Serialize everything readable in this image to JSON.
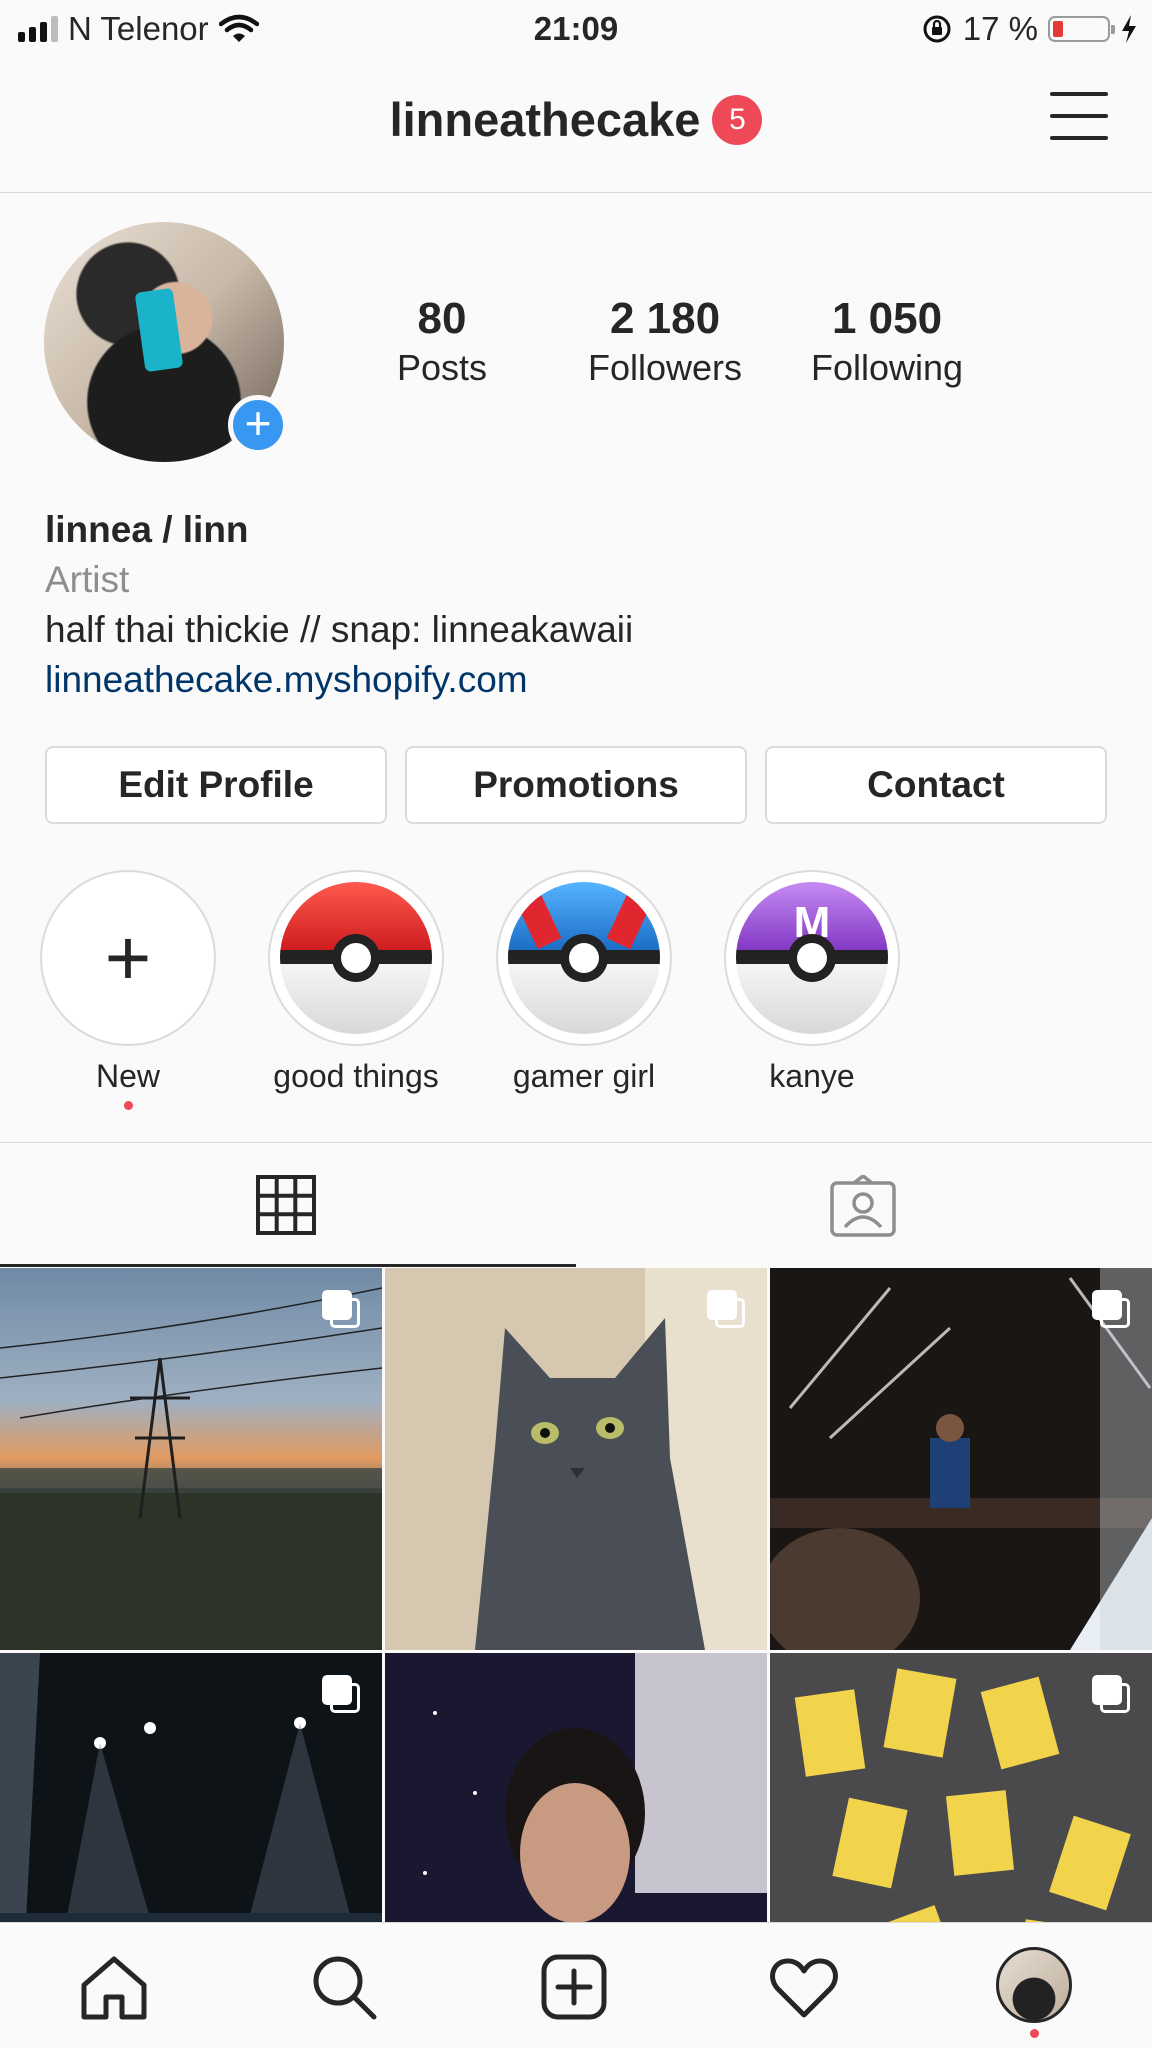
{
  "status_bar": {
    "carrier": "N Telenor",
    "time": "21:09",
    "battery_percent": "17 %",
    "battery_level": 0.17
  },
  "header": {
    "username": "linneathecake",
    "notification_count": "5"
  },
  "profile": {
    "stats": [
      {
        "value": "80",
        "label": "Posts"
      },
      {
        "value": "2 180",
        "label": "Followers"
      },
      {
        "value": "1 050",
        "label": "Following"
      }
    ],
    "display_name": "linnea / linn",
    "category": "Artist",
    "bio": "half thai thickie // snap: linneakawaii",
    "website": "linneathecake.myshopify.com"
  },
  "buttons": {
    "edit_profile": "Edit Profile",
    "promotions": "Promotions",
    "contact": "Contact"
  },
  "highlights": [
    {
      "label": "New",
      "icon": "plus-icon"
    },
    {
      "label": "good things",
      "icon": "poke-ball-icon"
    },
    {
      "label": "gamer girl",
      "icon": "great-ball-icon"
    },
    {
      "label": "kanye",
      "icon": "master-ball-icon"
    }
  ],
  "tabs": [
    {
      "icon": "grid-icon",
      "active": true
    },
    {
      "icon": "tagged-icon",
      "active": false
    }
  ],
  "posts": [
    {
      "subject": "power-line-sunset",
      "multi": true
    },
    {
      "subject": "grey-cat",
      "multi": true
    },
    {
      "subject": "concert-stage",
      "multi": true
    },
    {
      "subject": "stage-lights",
      "multi": true
    },
    {
      "subject": "selfie-room",
      "multi": false
    },
    {
      "subject": "pokemon-cards",
      "multi": true
    }
  ],
  "bottom_nav": [
    "home-icon",
    "search-icon",
    "add-post-icon",
    "activity-heart-icon",
    "profile-avatar"
  ],
  "colors": {
    "accent_blue": "#3897f0",
    "badge_red": "#ed4956",
    "link": "#003569"
  }
}
